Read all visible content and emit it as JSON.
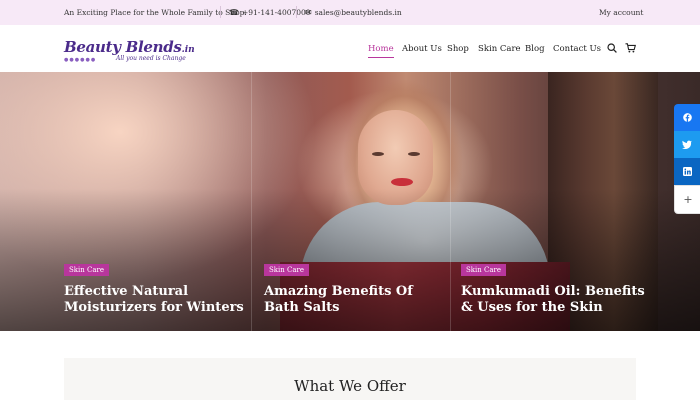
{
  "topbar": {
    "tagline": "An Exciting Place for the Whole Family to Shop.",
    "phone": "+91-141-4007000",
    "email": "sales@beautyblends.in",
    "account": "My account"
  },
  "logo": {
    "brand": "Beauty Blends",
    "tld": ".in",
    "slogan": "All you need is Change"
  },
  "nav": {
    "items": [
      "Home",
      "About Us",
      "Shop",
      "Skin Care",
      "Blog",
      "Contact Us"
    ],
    "active": "Home"
  },
  "posts": [
    {
      "category": "Skin Care",
      "title": "Effective Natural Moisturizers for Winters"
    },
    {
      "category": "Skin Care",
      "title": "Amazing Benefits Of Bath Salts"
    },
    {
      "category": "Skin Care",
      "title": "Kumkumadi Oil: Benefits & Uses for the Skin"
    }
  ],
  "social": {
    "icons": [
      "facebook-icon",
      "twitter-icon",
      "linkedin-icon",
      "plus-icon"
    ],
    "more_label": "+"
  },
  "section": {
    "title": "What We Offer"
  },
  "colors": {
    "accent": "#b8369c",
    "topbar_bg": "#f7e9f7",
    "brand": "#4a2a8a",
    "facebook": "#1877f2",
    "twitter": "#1d9bf0",
    "linkedin": "#0a66c2"
  }
}
